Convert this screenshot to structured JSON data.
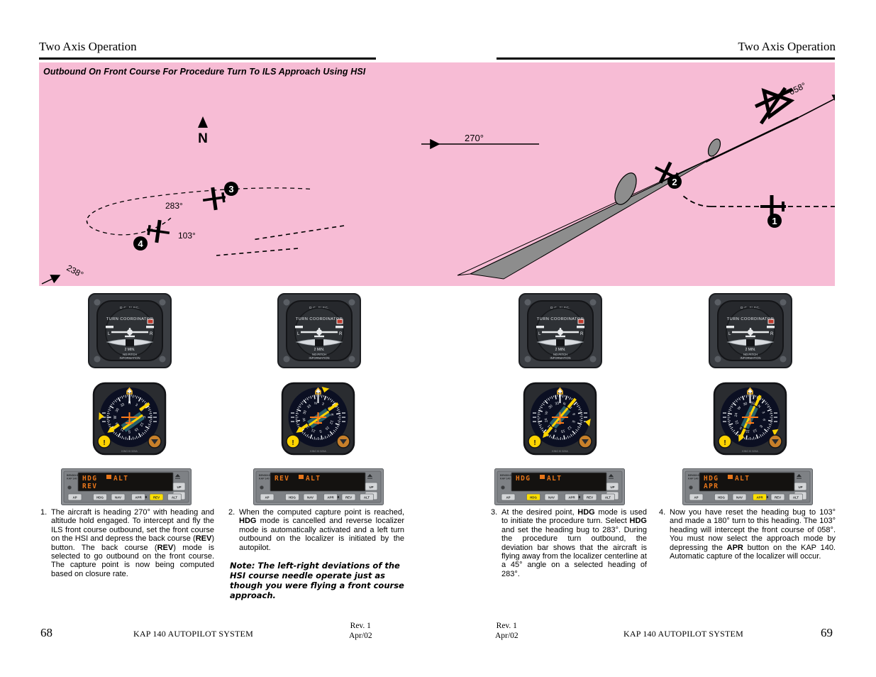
{
  "header": {
    "left_title": "Two Axis Operation",
    "right_title": "Two Axis Operation"
  },
  "diagram": {
    "title": "Outbound On Front Course For Procedure Turn To ILS Approach Using HSI",
    "background_color": "#f7bcd5",
    "north_label": "N",
    "labels": {
      "course_058": "058°",
      "heading_270": "270°",
      "heading_283": "283°",
      "heading_103": "103°",
      "course_238": "238°"
    },
    "callouts": [
      "1",
      "2",
      "3",
      "4"
    ]
  },
  "instruments": {
    "turn_coordinator": {
      "power_label": "D.C. ELEC.",
      "title": "TURN COORDINATOR",
      "left_mark": "L",
      "right_mark": "R",
      "rate_label": "2 MIN.",
      "caution_line1": "NO PITCH",
      "caution_line2": "INFORMATION"
    },
    "hsi": {
      "brand": "KING KI 525A"
    }
  },
  "autopilots": [
    {
      "brand_line1": "BENDIX/KING",
      "brand_line2": "KAP 140",
      "display_line1": "HDG",
      "display_ann": "■",
      "display_line1b": "ALT",
      "display_line2": "REV",
      "buttons": [
        "AP",
        "HDG",
        "NAV",
        "APR",
        "REV",
        "ALT"
      ],
      "active_button": "REV",
      "up_label": "UP",
      "dn_label": "DN"
    },
    {
      "brand_line1": "BENDIX/KING",
      "brand_line2": "KAP 140",
      "display_line1": "REV",
      "display_ann": "■",
      "display_line1b": "ALT",
      "display_line2": "",
      "buttons": [
        "AP",
        "HDG",
        "NAV",
        "APR",
        "REV",
        "ALT"
      ],
      "active_button": "",
      "up_label": "UP",
      "dn_label": "DN"
    },
    {
      "brand_line1": "BENDIX/KING",
      "brand_line2": "KAP 140",
      "display_line1": "HDG",
      "display_ann": "■",
      "display_line1b": "ALT",
      "display_line2": "",
      "buttons": [
        "AP",
        "HDG",
        "NAV",
        "APR",
        "REV",
        "ALT"
      ],
      "active_button": "HDG",
      "up_label": "UP",
      "dn_label": "DN"
    },
    {
      "brand_line1": "BENDIX/KING",
      "brand_line2": "KAP 140",
      "display_line1": "HDG",
      "display_ann": "■",
      "display_line1b": "ALT",
      "display_line2": "APR",
      "buttons": [
        "AP",
        "HDG",
        "NAV",
        "APR",
        "REV",
        "ALT"
      ],
      "active_button": "APR",
      "up_label": "UP",
      "dn_label": "DN"
    }
  ],
  "steps": [
    {
      "number": "1.",
      "html": "The aircraft is heading 270° with heading and altitude hold engaged. To intercept and fly the ILS front course outbound, set the front course on the HSI and depress  the back course (<b>REV</b>) button. The back course (<b>REV</b>) mode is selected to go outbound on the front course. The capture point is now being computed based on closure rate."
    },
    {
      "number": "2.",
      "html": "When the computed capture point is reached, <b>HDG</b> mode is cancelled and reverse localizer mode is automatically activated and a left turn outbound on the localizer is initiated by the autopilot."
    },
    {
      "number": "3.",
      "html": "At the desired point, <b>HDG</b> mode is used to initiate the procedure turn. Select <b>HDG</b> and set the heading bug to 283°. During the procedure turn outbound, the deviation bar shows that the aircraft is flying away from the localizer centerline at a 45° angle on a selected heading of 283°."
    },
    {
      "number": "4.",
      "html": "Now you have reset the heading bug to 103° and made a 180° turn to this heading. The 103° heading will intercept the front course of 058°. You must now select the approach mode by depressing the <b>APR</b> button on the KAP 140. Automatic capture of the localizer will occur."
    }
  ],
  "note": "Note: The left-right deviations of the HSI course needle operate just as though you were flying a front course approach.",
  "footer": {
    "left_page": "68",
    "right_page": "69",
    "left_center": "KAP 140 AUTOPILOT SYSTEM",
    "right_center": "KAP 140 AUTOPILOT SYSTEM",
    "rev_line1": "Rev. 1",
    "rev_line2": "Apr/02"
  }
}
